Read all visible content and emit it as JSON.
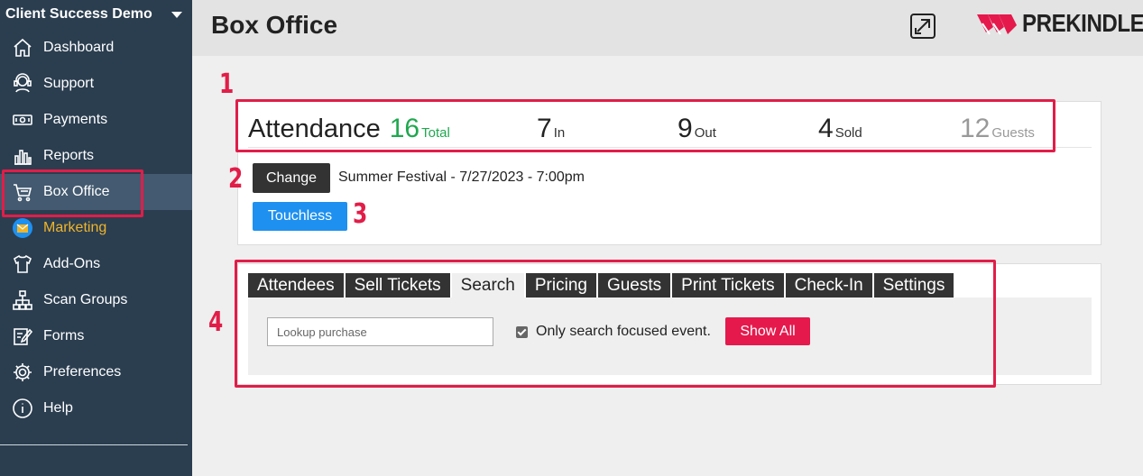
{
  "sidebar": {
    "org_name": "Client Success Demo",
    "items": [
      {
        "label": "Dashboard",
        "icon": "house-icon"
      },
      {
        "label": "Support",
        "icon": "headset-icon"
      },
      {
        "label": "Payments",
        "icon": "cash-icon"
      },
      {
        "label": "Reports",
        "icon": "bar-chart-icon"
      },
      {
        "label": "Box Office",
        "icon": "cart-icon",
        "active": true
      },
      {
        "label": "Marketing",
        "icon": "envelope-icon",
        "color": "#f0b429"
      },
      {
        "label": "Add-Ons",
        "icon": "shirt-icon"
      },
      {
        "label": "Scan Groups",
        "icon": "sitemap-icon"
      },
      {
        "label": "Forms",
        "icon": "form-edit-icon"
      },
      {
        "label": "Preferences",
        "icon": "gear-icon"
      },
      {
        "label": "Help",
        "icon": "info-icon"
      }
    ]
  },
  "header": {
    "title": "Box Office",
    "brand": "PREKINDLE"
  },
  "attendance": {
    "title": "Attendance",
    "total": {
      "value": "16",
      "label": "Total"
    },
    "in": {
      "value": "7",
      "label": "In"
    },
    "out": {
      "value": "9",
      "label": "Out"
    },
    "sold": {
      "value": "4",
      "label": "Sold"
    },
    "guests": {
      "value": "12",
      "label": "Guests"
    }
  },
  "event": {
    "change_label": "Change",
    "name": "Summer Festival - 7/27/2023 - 7:00pm",
    "touchless_label": "Touchless"
  },
  "tabs": [
    "Attendees",
    "Sell Tickets",
    "Search",
    "Pricing",
    "Guests",
    "Print Tickets",
    "Check-In",
    "Settings"
  ],
  "search": {
    "placeholder": "Lookup purchase",
    "checkbox_label": "Only search focused event.",
    "checkbox_checked": true,
    "show_all_label": "Show All"
  },
  "annotations": [
    "1",
    "2",
    "3",
    "4"
  ],
  "colors": {
    "sidebar": "#2b3e50",
    "accent": "#e11d48",
    "green": "#1fa84f",
    "blue": "#1e90f0",
    "marketing": "#f0b429"
  }
}
